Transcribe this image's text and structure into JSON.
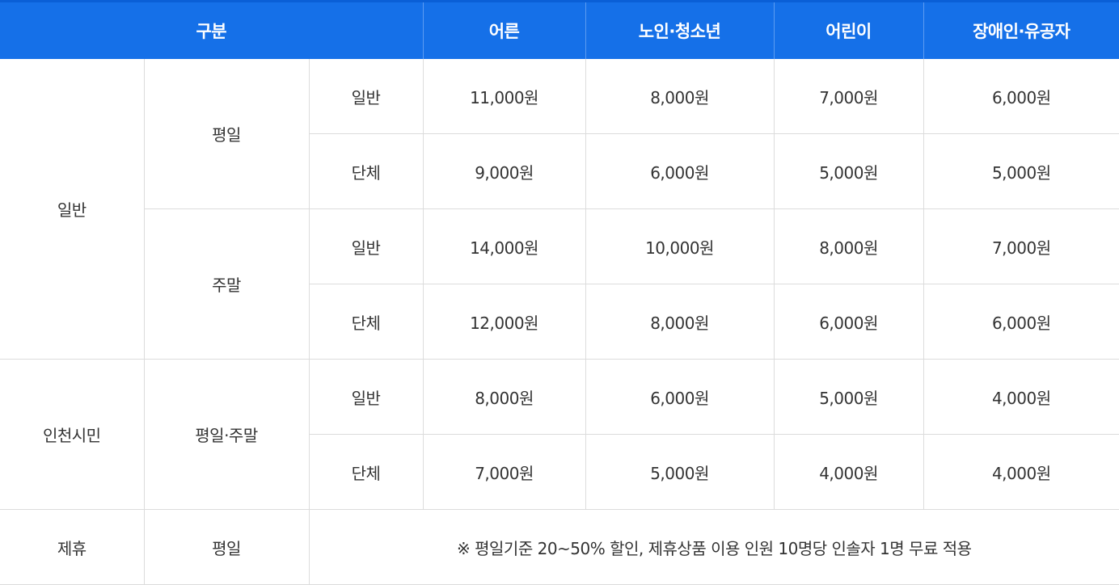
{
  "header": {
    "category": "구분",
    "adult": "어른",
    "senior_youth": "노인·청소년",
    "child": "어린이",
    "disabled_merit": "장애인·유공자"
  },
  "groups": {
    "general": "일반",
    "citizen": "인천시민",
    "partner": "제휴"
  },
  "periods": {
    "weekday": "평일",
    "weekend": "주말",
    "weekday_weekend": "평일·주말",
    "partner_weekday": "평일"
  },
  "rows": [
    {
      "type": "일반",
      "adult": "11,000원",
      "senior_youth": "8,000원",
      "child": "7,000원",
      "disabled_merit": "6,000원"
    },
    {
      "type": "단체",
      "adult": "9,000원",
      "senior_youth": "6,000원",
      "child": "5,000원",
      "disabled_merit": "5,000원"
    },
    {
      "type": "일반",
      "adult": "14,000원",
      "senior_youth": "10,000원",
      "child": "8,000원",
      "disabled_merit": "7,000원"
    },
    {
      "type": "단체",
      "adult": "12,000원",
      "senior_youth": "8,000원",
      "child": "6,000원",
      "disabled_merit": "6,000원"
    },
    {
      "type": "일반",
      "adult": "8,000원",
      "senior_youth": "6,000원",
      "child": "5,000원",
      "disabled_merit": "4,000원"
    },
    {
      "type": "단체",
      "adult": "7,000원",
      "senior_youth": "5,000원",
      "child": "4,000원",
      "disabled_merit": "4,000원"
    }
  ],
  "partner_note": "※ 평일기준 20~50% 할인, 제휴상품 이용 인원 10명당 인솔자 1명 무료 적용",
  "colors": {
    "header_bg": "#1570e8",
    "header_text": "#ffffff",
    "border": "#dcdcdc",
    "body_text": "#333333"
  }
}
